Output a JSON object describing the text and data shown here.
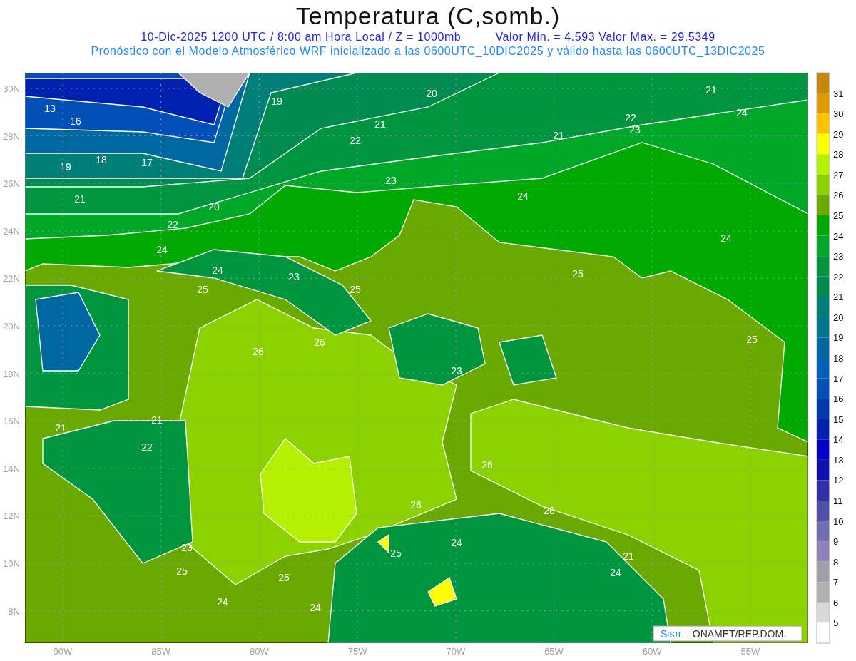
{
  "title": "Temperatura (C,somb.)",
  "info_line": {
    "valid_time": "10-Dic-2025  1200 UTC / 8:00 am Hora Local / Z = 1000mb",
    "extremes": "Valor Min. = 4.593  Valor Max. = 29.5349"
  },
  "model_line": "Pronóstico con el Modelo Atmosférico WRF inicializado a las 0600UTC_10DIC2025 y válido hasta las  0600UTC_13DIC2025",
  "map": {
    "lat_labels": [
      "30N",
      "28N",
      "26N",
      "24N",
      "22N",
      "20N",
      "18N",
      "16N",
      "14N",
      "12N",
      "10N",
      "8N"
    ],
    "lon_labels": [
      "90W",
      "85W",
      "80W",
      "75W",
      "70W",
      "65W",
      "60W",
      "55W"
    ],
    "contour_labels": [
      "13",
      "16",
      "19",
      "20",
      "21",
      "24",
      "22",
      "23",
      "21",
      "21",
      "22",
      "18",
      "17",
      "19",
      "23",
      "24",
      "21",
      "20",
      "22",
      "24",
      "24",
      "24",
      "23",
      "25",
      "25",
      "25",
      "26",
      "26",
      "25",
      "23",
      "21",
      "21",
      "22",
      "26",
      "26",
      "26",
      "23",
      "25",
      "24",
      "25",
      "25",
      "24",
      "24",
      "24",
      "21"
    ],
    "credit": {
      "logo": "Sisπ",
      "text": "– ONAMET/REP.DOM."
    }
  },
  "colorbar": {
    "bins": [
      {
        "color": "#c8860a"
      },
      {
        "color": "#e29a00"
      },
      {
        "color": "#ffc000"
      },
      {
        "color": "#ffff00"
      },
      {
        "color": "#b4f000"
      },
      {
        "color": "#8cd200"
      },
      {
        "color": "#6aaa00"
      },
      {
        "color": "#00aa00"
      },
      {
        "color": "#00a828"
      },
      {
        "color": "#009640"
      },
      {
        "color": "#008c50"
      },
      {
        "color": "#007f78"
      },
      {
        "color": "#00758c"
      },
      {
        "color": "#0068a0"
      },
      {
        "color": "#0060b8"
      },
      {
        "color": "#0050b8"
      },
      {
        "color": "#0038b0"
      },
      {
        "color": "#0020b0"
      },
      {
        "color": "#0000c8"
      },
      {
        "color": "#1010b0"
      },
      {
        "color": "#3030a8"
      },
      {
        "color": "#5050a8"
      },
      {
        "color": "#7070b0"
      },
      {
        "color": "#9080b8"
      },
      {
        "color": "#a0a0a8"
      },
      {
        "color": "#b0b0b0"
      },
      {
        "color": "#d8d8d8"
      },
      {
        "color": "#ffffff"
      }
    ],
    "labels": [
      "31",
      "30",
      "29",
      "28",
      "27",
      "26",
      "25",
      "24",
      "23",
      "22",
      "21",
      "20",
      "19",
      "18",
      "17",
      "16",
      "15",
      "14",
      "13",
      "12",
      "11",
      "10",
      "9",
      "8",
      "7",
      "6",
      "5"
    ]
  }
}
